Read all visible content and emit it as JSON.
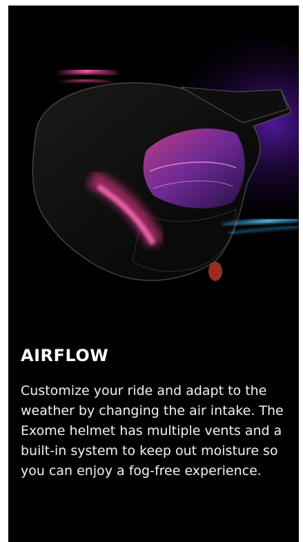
{
  "feature": {
    "image": {
      "icon": "helmet-airflow-illustration",
      "colors": {
        "background": "#000000",
        "pink_glow": "#ff3d9a",
        "blue_glow": "#38b6ff",
        "purple_glow": "#7b2ff7"
      }
    },
    "title": "AIRFLOW",
    "description": "Customize your ride and adapt to the weather by changing the air intake. The Exome helmet has multiple vents and a built-in system to keep out moisture so you can enjoy a fog-free experience."
  }
}
